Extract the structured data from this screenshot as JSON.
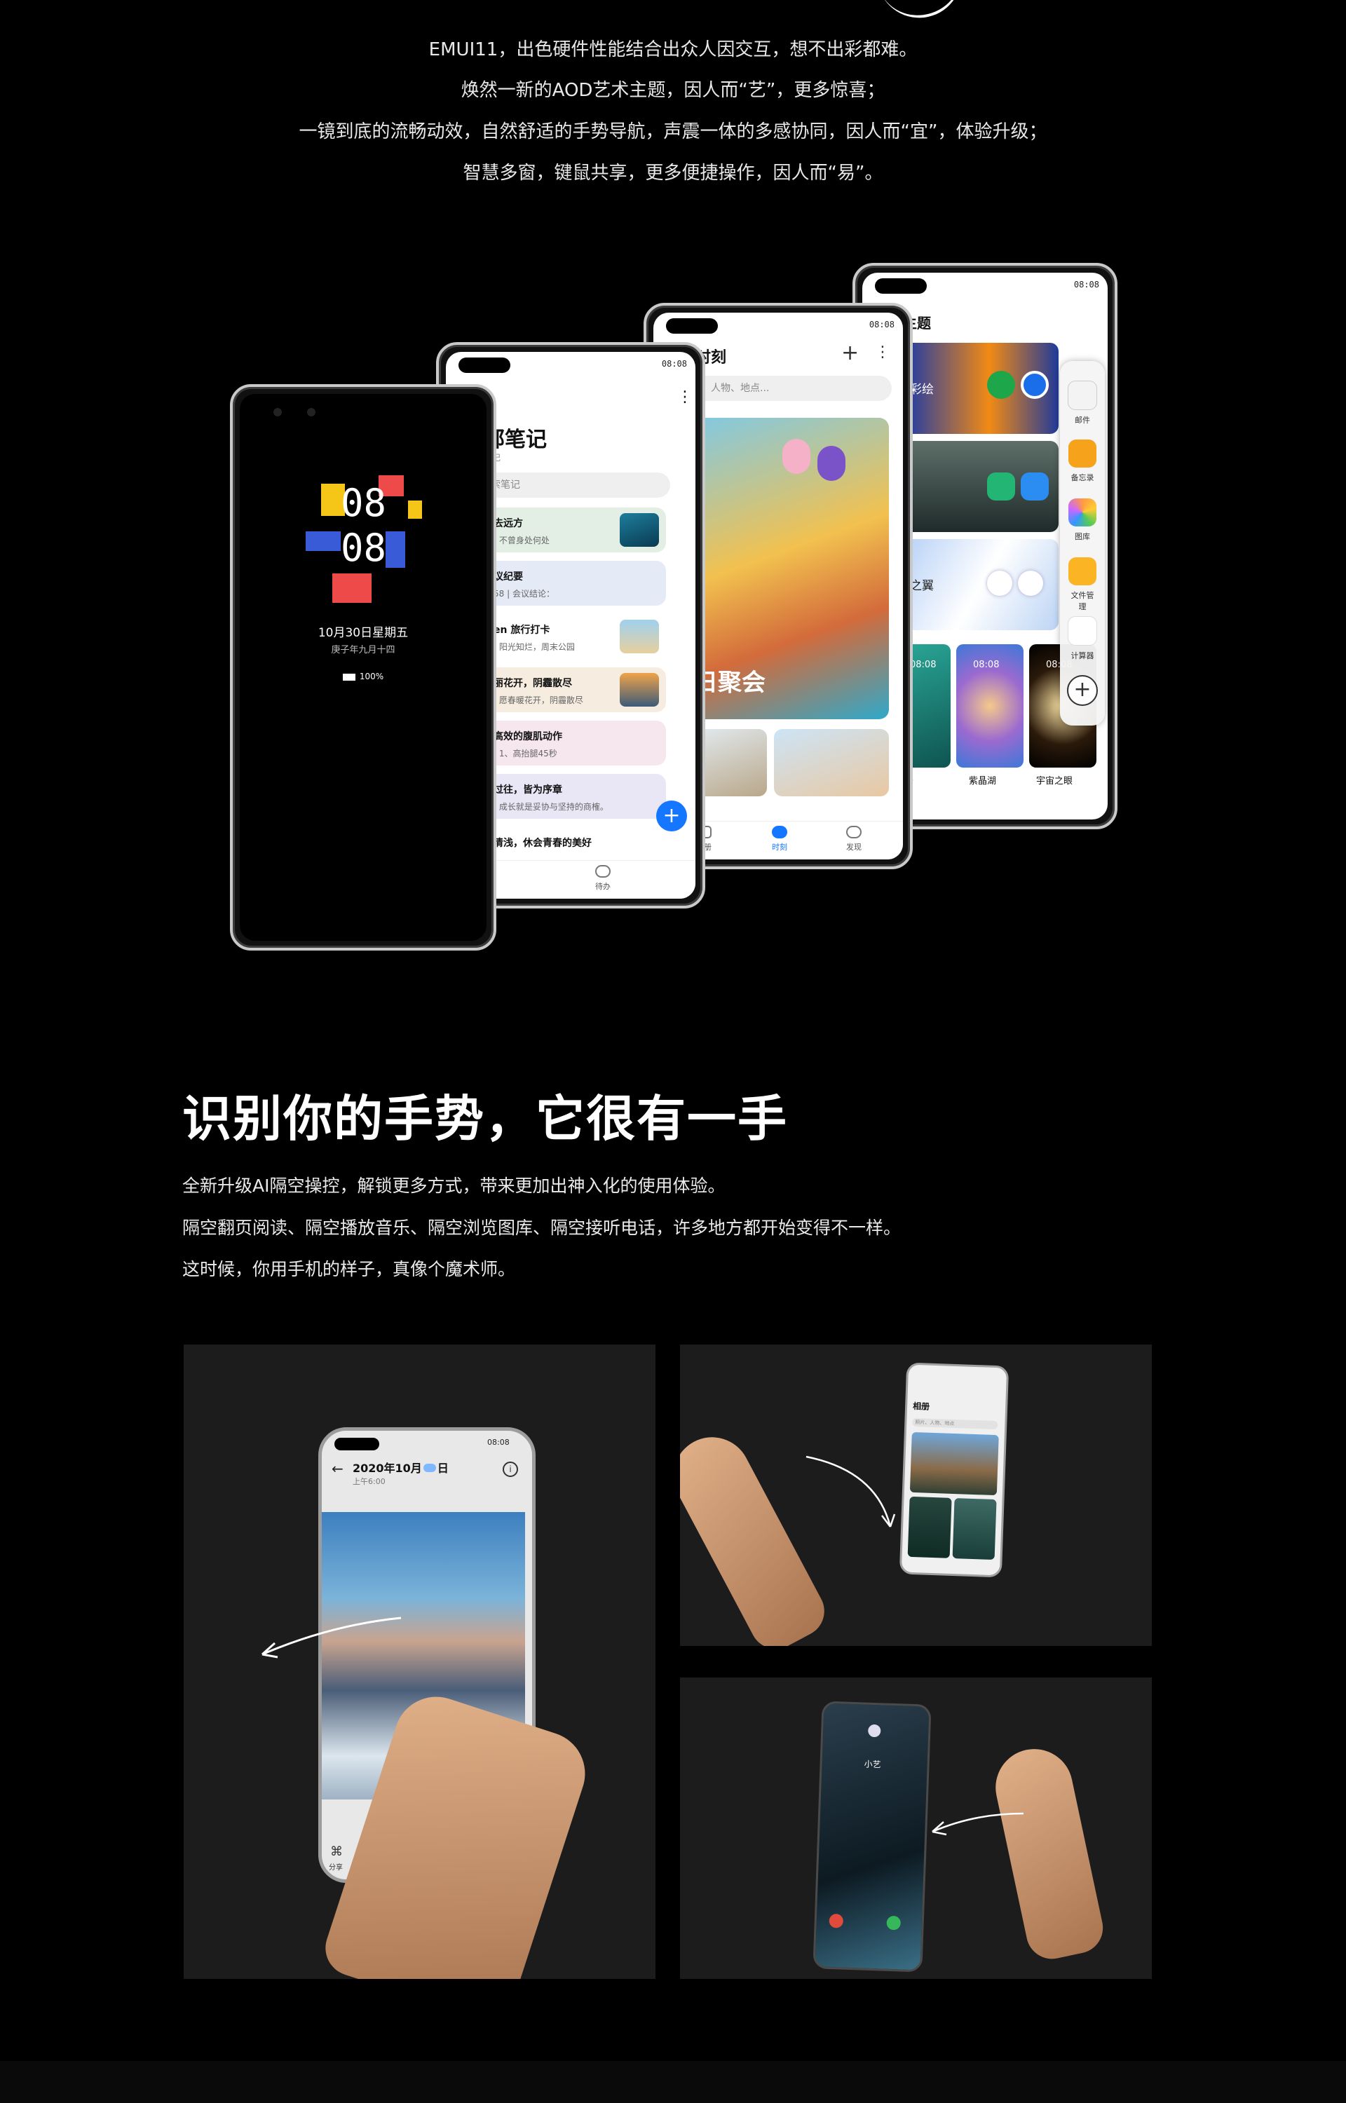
{
  "intro": {
    "lines": [
      "EMUI11，出色硬件性能结合出众人因交互，想不出彩都难。",
      "焕然一新的AOD艺术主题，因人而“艺”，更多惊喜；",
      "一镜到底的流畅动效，自然舒适的手势导航，声震一体的多感协同，因人而“宜”，体验升级；",
      "智慧多窗，键鼠共享，更多便捷操作，因人而“易”。"
    ]
  },
  "aod_phone": {
    "time_top": "08",
    "time_bottom": "08",
    "date": "10月30日星期五",
    "lunar": "庚子年九月十四",
    "battery": "100%"
  },
  "notes_phone": {
    "status_time": "08:08",
    "title": "部笔记",
    "subtitle": "笔记",
    "search": "索笔记",
    "items": [
      {
        "title": "去远方",
        "sub": "| 不曾身处何处"
      },
      {
        "title": "议纪要",
        "sub": "58 | 会议结论："
      },
      {
        "title": "en 旅行打卡",
        "sub": "| 阳光知烂，周末公园"
      },
      {
        "title": "丽花开，阴霾散尽",
        "sub": "| 愿春暖花开，阴霾散尽"
      },
      {
        "title": "高效的腹肌动作",
        "sub": "| 1、高抬腿45秒"
      },
      {
        "title": "过往，皆为序章",
        "sub": "| 成长就是妥协与坚持的商榷。"
      },
      {
        "title": "清浅，休会青春的美好",
        "sub": ""
      }
    ],
    "tab_notes": "笔记",
    "tab_todo": "待办"
  },
  "moments_phone": {
    "status_time": "08:08",
    "title": "时刻",
    "search": "片、人物、地点...",
    "card_title": "日聚会",
    "tabs": [
      "相册",
      "时刻",
      "发现"
    ]
  },
  "theme_phone": {
    "status_time": "08:08",
    "title": "主题",
    "cards": [
      "彩绘",
      "",
      "之翼"
    ],
    "bottom_labels": [
      "少",
      "紫晶湖",
      "宇宙之眼"
    ],
    "thumb_time": "08:08",
    "dock": [
      "邮件",
      "备忘录",
      "图库",
      "文件管理",
      "计算器"
    ]
  },
  "section2": {
    "title": "识别你的手势，它很有一手",
    "lines": [
      "全新升级AI隔空操控，解锁更多方式，带来更加出神入化的使用体验。",
      "隔空翻页阅读、隔空播放音乐、隔空浏览图库、隔空接听电话，许多地方都开始变得不一样。",
      "这时候，你用手机的样子，真像个魔术师。"
    ]
  },
  "panel1": {
    "status_time": "08:08",
    "date_title": "2020年10月",
    "date_title_end": "日",
    "time_sub": "上午6:00",
    "share": "分享"
  },
  "panel2": {
    "gallery_title": "相册",
    "search": "照片、人物、地点"
  },
  "panel3": {
    "caller": "小艺"
  },
  "colors": {
    "background": "#000000",
    "accent_blue": "#1577ff"
  }
}
